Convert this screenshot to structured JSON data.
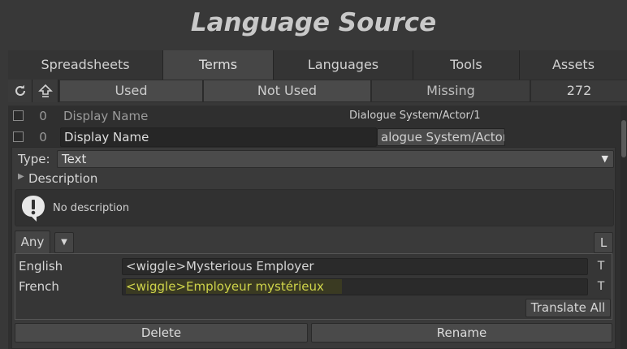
{
  "window": {
    "title": "Language Source"
  },
  "tabs": [
    {
      "label": "Spreadsheets",
      "active": false
    },
    {
      "label": "Terms",
      "active": true
    },
    {
      "label": "Languages",
      "active": false
    },
    {
      "label": "Tools",
      "active": false
    },
    {
      "label": "Assets",
      "active": false
    }
  ],
  "toolbar": {
    "refresh_icon": "refresh-icon",
    "up_icon": "up-arrow-icon",
    "filters": [
      {
        "label": "Used",
        "active": true
      },
      {
        "label": "Not Used",
        "active": true
      },
      {
        "label": "Missing",
        "active": false
      }
    ],
    "categories_label": "272 categories"
  },
  "terms": [
    {
      "count": "0",
      "name": "Display Name",
      "category": "Dialogue System/Actor/1"
    },
    {
      "count": "0",
      "name": "Display Name",
      "category": "alogue System/Actor"
    }
  ],
  "term_editor": {
    "type_label": "Type:",
    "type_value": "Text",
    "description_label": "Description",
    "description_text": "No description",
    "info_icon": "exclamation-icon",
    "lang_filter": "Any",
    "lang_filter_arrow": "▼",
    "l_button": "L",
    "languages": [
      {
        "name": "English",
        "value": "<wiggle>Mysterious Employer",
        "translate_btn": "T",
        "highlight": false
      },
      {
        "name": "French",
        "value": "<wiggle>Employeur mystérieux",
        "translate_btn": "T",
        "highlight": true
      }
    ],
    "translate_all": "Translate All",
    "delete_label": "Delete",
    "rename_label": "Rename"
  },
  "colors": {
    "highlight_text": "#cfd44a",
    "highlight_bg": "#3a3a22"
  }
}
